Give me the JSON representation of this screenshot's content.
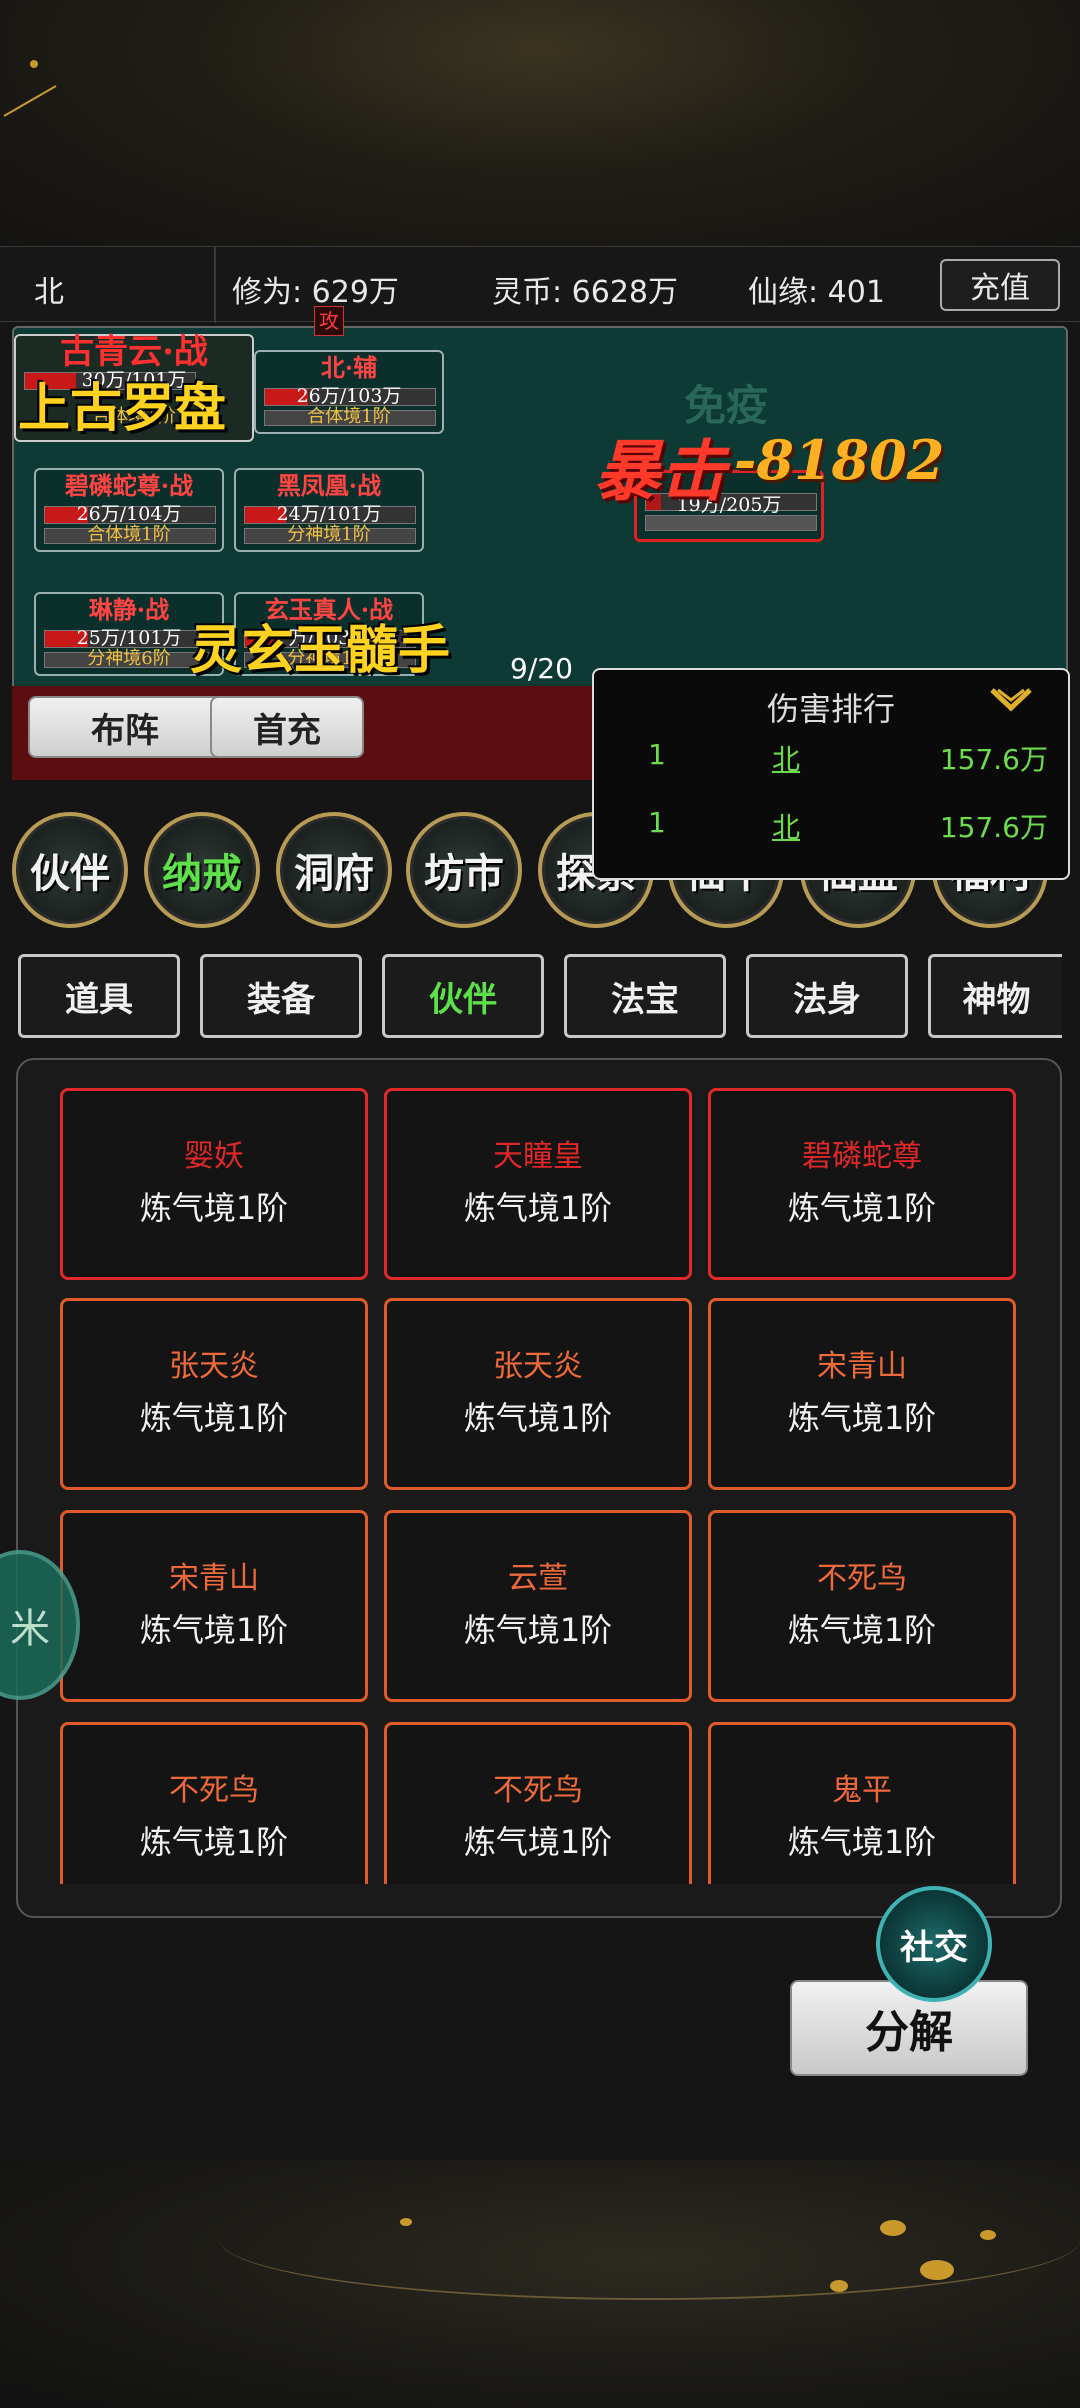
{
  "topbar": {
    "player_name": "北",
    "xiuwei": "修为: 629万",
    "lingbi": "灵币: 6628万",
    "xianyuan": "仙缘: 401",
    "recharge": "充值"
  },
  "battle": {
    "units": [
      {
        "name": "古青云·战",
        "hp": "30万/101万",
        "level": "合体境1阶",
        "hp_ratio": 0.3
      },
      {
        "name": "北·辅",
        "hp": "26万/103万",
        "level": "合体境1阶",
        "hp_ratio": 0.25
      },
      {
        "name": "碧磷蛇尊·战",
        "hp": "26万/104万",
        "level": "合体境1阶",
        "hp_ratio": 0.25
      },
      {
        "name": "黑凤凰·战",
        "hp": "24万/101万",
        "level": "分神境1阶",
        "hp_ratio": 0.24
      },
      {
        "name": "琳静·战",
        "hp": "25万/101万",
        "level": "分神境6阶",
        "hp_ratio": 0.25
      },
      {
        "name": "玄玉真人·战",
        "hp": "万/103万",
        "level": "分神境1阶",
        "hp_ratio": 0.2
      }
    ],
    "attack_icon": "攻",
    "enemy": {
      "hp": "19万/205万",
      "hp_ratio": 0.09
    },
    "fx_relic": "上古罗盘",
    "fx_skill": "灵玄玉髓手",
    "fx_crit": "暴击",
    "fx_damage": "-81802",
    "fx_immune": "免疫",
    "wave": "9/20",
    "btn_formation": "布阵",
    "btn_firstpay": "首充"
  },
  "rank": {
    "title": "伤害排行",
    "rows": [
      {
        "pos": "1",
        "who": "北",
        "dmg": "157.6万"
      },
      {
        "pos": "1",
        "who": "北",
        "dmg": "157.6万"
      }
    ]
  },
  "menu_circles": [
    "伙伴",
    "纳戒",
    "洞府",
    "坊市",
    "探索",
    "仙十",
    "仙盟",
    "福利"
  ],
  "tabs": [
    "道具",
    "装备",
    "伙伴",
    "法宝",
    "法身",
    "神物"
  ],
  "active_tab": "伙伴",
  "cards": [
    {
      "name": "婴妖",
      "level": "炼气境1阶",
      "rarity": "red"
    },
    {
      "name": "天瞳皇",
      "level": "炼气境1阶",
      "rarity": "red"
    },
    {
      "name": "碧磷蛇尊",
      "level": "炼气境1阶",
      "rarity": "red"
    },
    {
      "name": "张天炎",
      "level": "炼气境1阶",
      "rarity": "orange"
    },
    {
      "name": "张天炎",
      "level": "炼气境1阶",
      "rarity": "orange"
    },
    {
      "name": "宋青山",
      "level": "炼气境1阶",
      "rarity": "orange"
    },
    {
      "name": "宋青山",
      "level": "炼气境1阶",
      "rarity": "orange"
    },
    {
      "name": "云萱",
      "level": "炼气境1阶",
      "rarity": "orange"
    },
    {
      "name": "不死鸟",
      "level": "炼气境1阶",
      "rarity": "orange"
    },
    {
      "name": "不死鸟",
      "level": "炼气境1阶",
      "rarity": "orange"
    },
    {
      "name": "不死鸟",
      "level": "炼气境1阶",
      "rarity": "orange"
    },
    {
      "name": "鬼平",
      "level": "炼气境1阶",
      "rarity": "orange"
    }
  ],
  "buttons": {
    "decompose": "分解",
    "social": "社交",
    "side_float": "米"
  },
  "colors": {
    "red_rarity": "#e02828",
    "orange_rarity": "#e05a2a",
    "active_tab_text": "#5ee04a",
    "rank_text": "#6ddc4c",
    "battle_bg": "#0d3a34"
  }
}
